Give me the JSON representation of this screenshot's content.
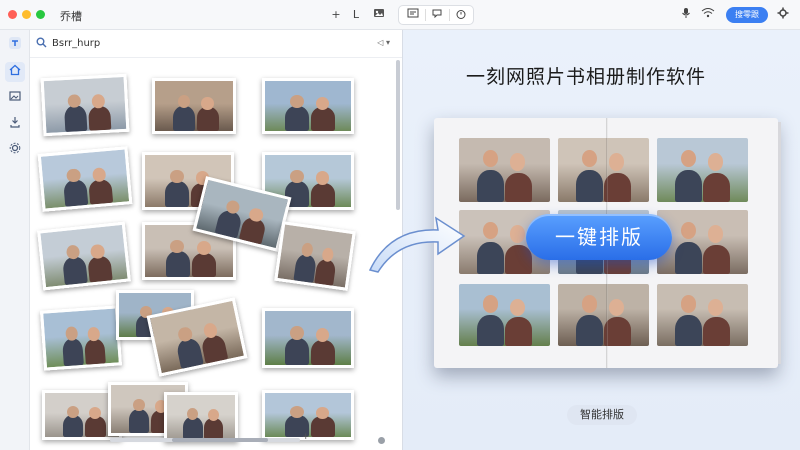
{
  "app": {
    "title": "乔槽"
  },
  "titlebar": {
    "icons": [
      "plus-icon",
      "bracket-icon",
      "image-icon",
      "layout-icon",
      "chat-icon",
      "timer-icon",
      "mic-icon",
      "wifi-icon",
      "gear-icon"
    ],
    "plus_glyph": "+",
    "bracket_glyph": "L",
    "blue_button_label": "搜零跟"
  },
  "rail": {
    "items": [
      "home-icon",
      "photo-icon",
      "import-icon",
      "settings-icon"
    ]
  },
  "gallery": {
    "search_text": "Bsrr_hurp",
    "search_right": "◁  ▾"
  },
  "preview": {
    "headline": "一刻网照片书相册制作软件",
    "pill_label": "一键排版",
    "bottom_button": "智能排版"
  },
  "colors": {
    "accent": "#3b7ff2",
    "pill_top": "#5aa0ff",
    "pill_bottom": "#2a6ee8",
    "panel_bg": "#e6eef9"
  }
}
